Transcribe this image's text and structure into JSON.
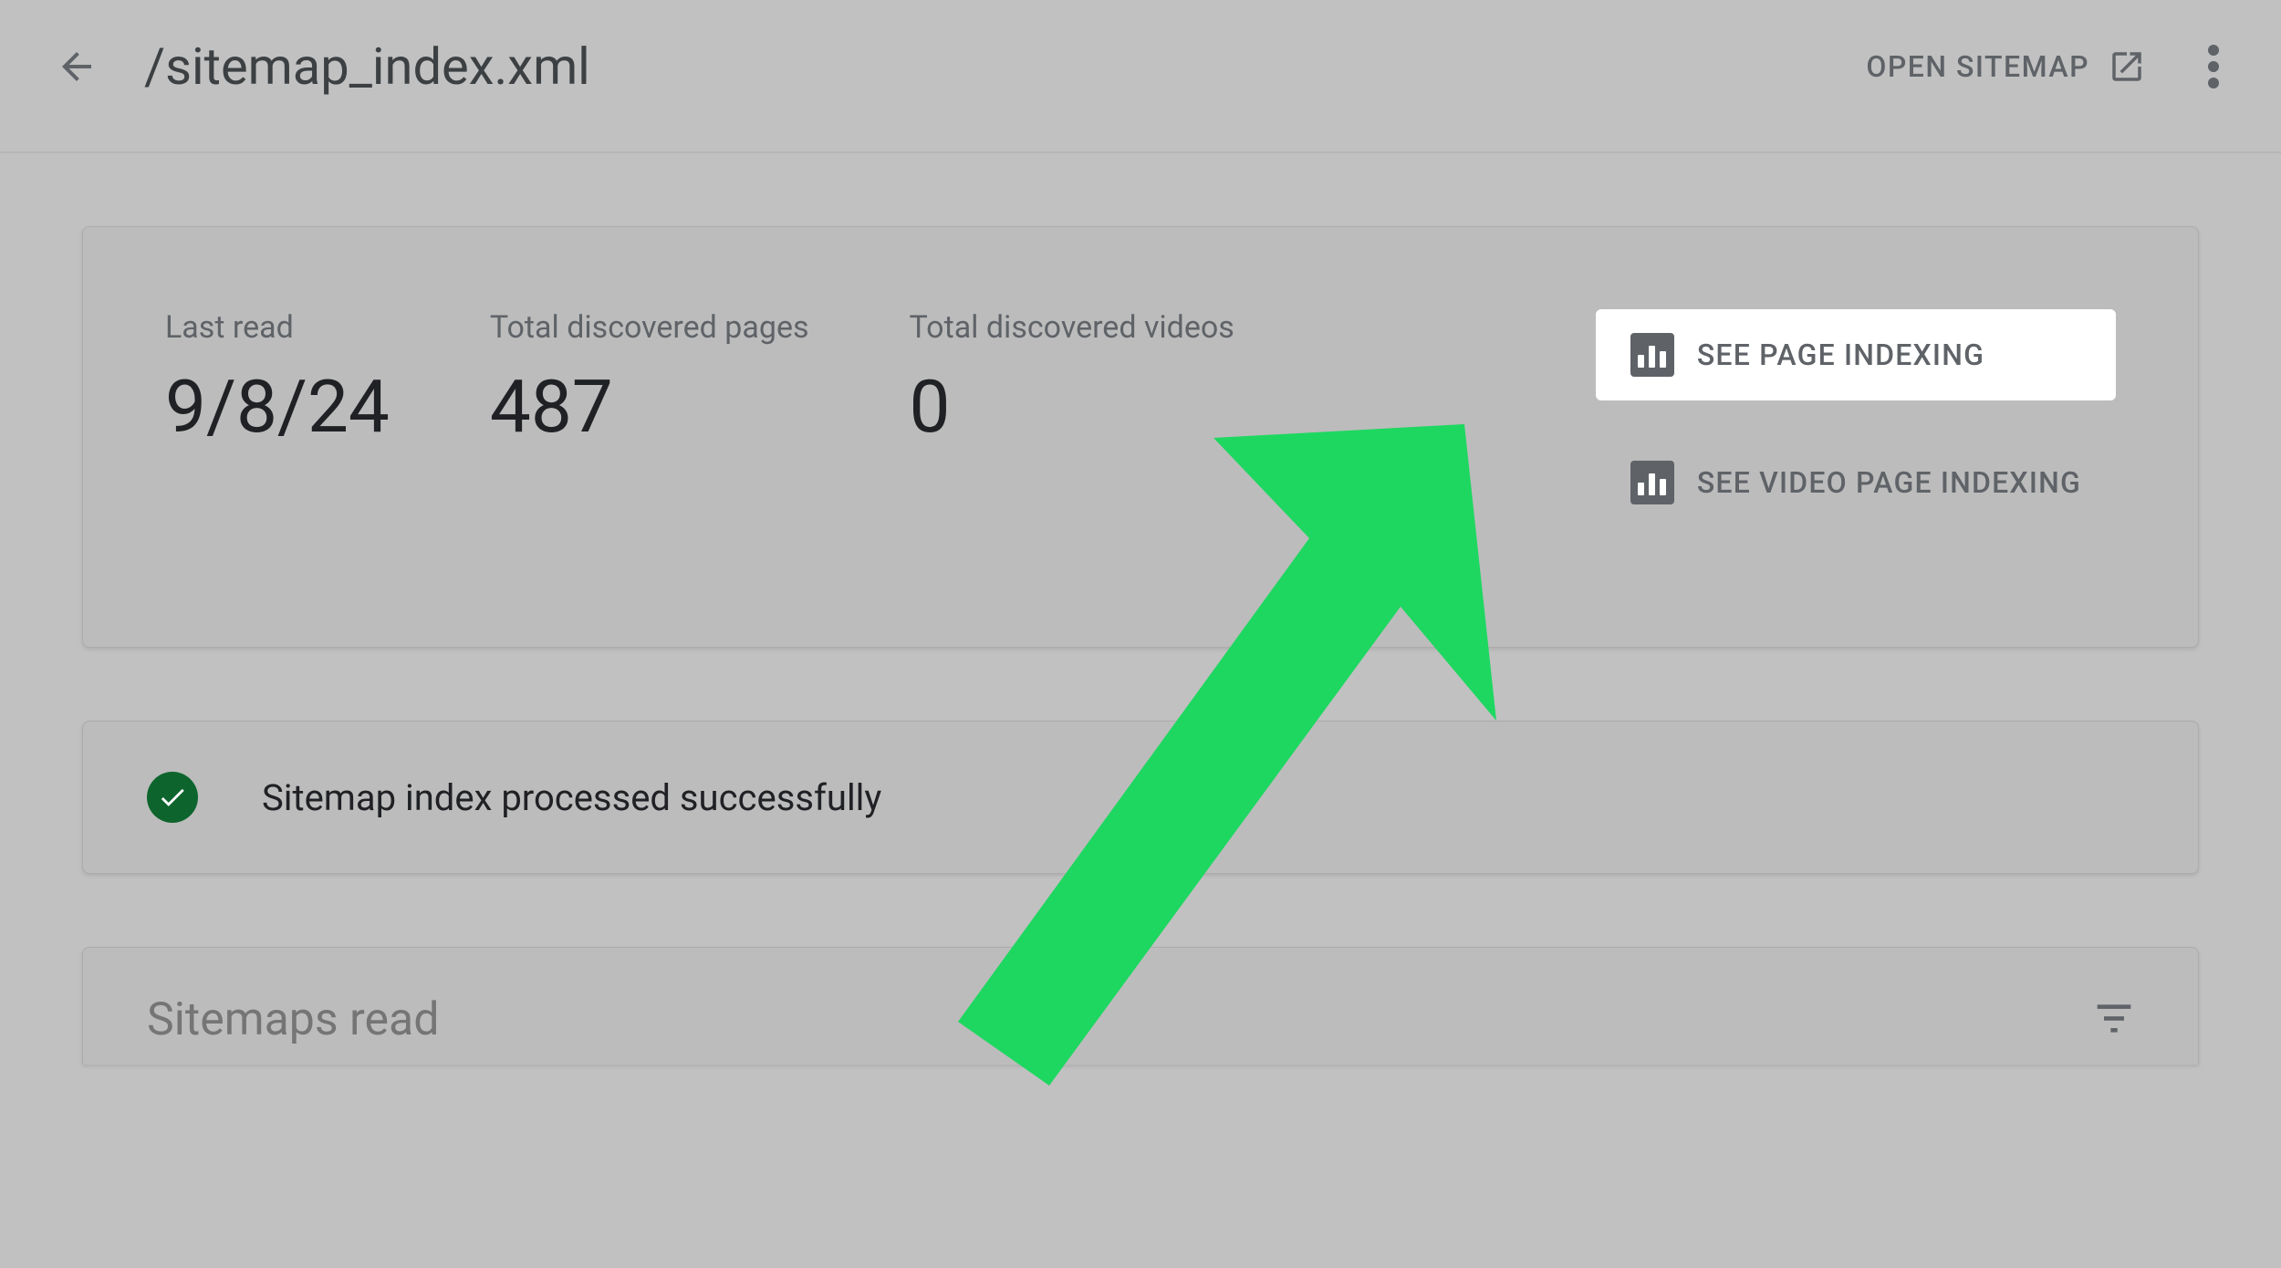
{
  "header": {
    "title": "/sitemap_index.xml",
    "open_sitemap_label": "OPEN SITEMAP"
  },
  "stats": {
    "last_read": {
      "label": "Last read",
      "value": "9/8/24"
    },
    "total_pages": {
      "label": "Total discovered pages",
      "value": "487"
    },
    "total_videos": {
      "label": "Total discovered videos",
      "value": "0"
    }
  },
  "actions": {
    "page_indexing": "SEE PAGE INDEXING",
    "video_indexing": "SEE VIDEO PAGE INDEXING"
  },
  "status": {
    "message": "Sitemap index processed successfully"
  },
  "sitemaps": {
    "title": "Sitemaps read"
  }
}
